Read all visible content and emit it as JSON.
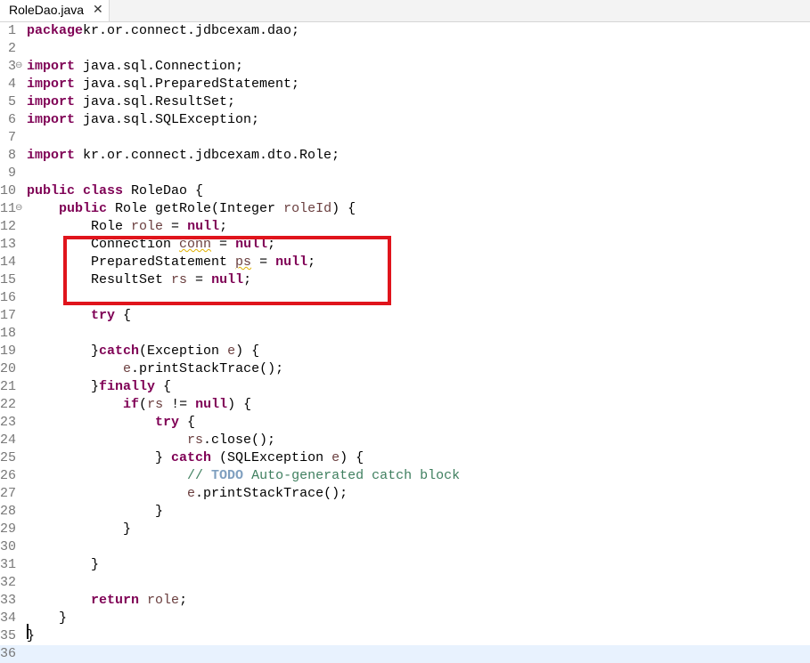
{
  "tab": {
    "title": "RoleDao.java",
    "close": "✕"
  },
  "editor": {
    "lines": [
      {
        "num": "1",
        "tokens": [
          [
            "kw",
            "package"
          ],
          [
            "",
            "kr.or.connect.jdbcexam.dao;"
          ]
        ]
      },
      {
        "num": "2",
        "tokens": []
      },
      {
        "num": "3",
        "fold": "⊖",
        "tokens": [
          [
            "kw",
            "import"
          ],
          [
            "",
            " java.sql.Connection;"
          ]
        ]
      },
      {
        "num": "4",
        "tokens": [
          [
            "kw",
            "import"
          ],
          [
            "",
            " java.sql.PreparedStatement;"
          ]
        ]
      },
      {
        "num": "5",
        "tokens": [
          [
            "kw",
            "import"
          ],
          [
            "",
            " java.sql.ResultSet;"
          ]
        ]
      },
      {
        "num": "6",
        "tokens": [
          [
            "kw",
            "import"
          ],
          [
            "",
            " java.sql.SQLException;"
          ]
        ]
      },
      {
        "num": "7",
        "tokens": []
      },
      {
        "num": "8",
        "tokens": [
          [
            "kw",
            "import"
          ],
          [
            "",
            " kr.or.connect.jdbcexam.dto.Role;"
          ]
        ]
      },
      {
        "num": "9",
        "tokens": []
      },
      {
        "num": "10",
        "tokens": [
          [
            "kw",
            "public class"
          ],
          [
            "",
            " RoleDao {"
          ]
        ]
      },
      {
        "num": "11",
        "fold": "⊖",
        "tokens": [
          [
            "",
            "    "
          ],
          [
            "kw",
            "public"
          ],
          [
            "",
            " Role getRole(Integer "
          ],
          [
            "var",
            "roleId"
          ],
          [
            "",
            ") {"
          ]
        ]
      },
      {
        "num": "12",
        "tokens": [
          [
            "",
            "        Role "
          ],
          [
            "var",
            "role"
          ],
          [
            "",
            " = "
          ],
          [
            "kw",
            "null"
          ],
          [
            "",
            ";"
          ]
        ]
      },
      {
        "num": "13",
        "tokens": [
          [
            "",
            "        Connection "
          ],
          [
            "var squig",
            "conn"
          ],
          [
            "",
            " = "
          ],
          [
            "kw",
            "null"
          ],
          [
            "",
            ";"
          ]
        ]
      },
      {
        "num": "14",
        "tokens": [
          [
            "",
            "        PreparedStatement "
          ],
          [
            "var squig",
            "ps"
          ],
          [
            "",
            " = "
          ],
          [
            "kw",
            "null"
          ],
          [
            "",
            ";"
          ]
        ]
      },
      {
        "num": "15",
        "tokens": [
          [
            "",
            "        ResultSet "
          ],
          [
            "var",
            "rs"
          ],
          [
            "",
            " = "
          ],
          [
            "kw",
            "null"
          ],
          [
            "",
            ";"
          ]
        ]
      },
      {
        "num": "16",
        "tokens": []
      },
      {
        "num": "17",
        "tokens": [
          [
            "",
            "        "
          ],
          [
            "kw",
            "try"
          ],
          [
            "",
            " {"
          ]
        ]
      },
      {
        "num": "18",
        "tokens": []
      },
      {
        "num": "19",
        "tokens": [
          [
            "",
            "        }"
          ],
          [
            "kw",
            "catch"
          ],
          [
            "",
            "(Exception "
          ],
          [
            "var",
            "e"
          ],
          [
            "",
            ") {"
          ]
        ]
      },
      {
        "num": "20",
        "tokens": [
          [
            "",
            "            "
          ],
          [
            "var",
            "e"
          ],
          [
            "",
            ".printStackTrace();"
          ]
        ]
      },
      {
        "num": "21",
        "tokens": [
          [
            "",
            "        }"
          ],
          [
            "kw",
            "finally"
          ],
          [
            "",
            " {"
          ]
        ]
      },
      {
        "num": "22",
        "tokens": [
          [
            "",
            "            "
          ],
          [
            "kw",
            "if"
          ],
          [
            "",
            "("
          ],
          [
            "var",
            "rs"
          ],
          [
            "",
            " != "
          ],
          [
            "kw",
            "null"
          ],
          [
            "",
            ") {"
          ]
        ]
      },
      {
        "num": "23",
        "tokens": [
          [
            "",
            "                "
          ],
          [
            "kw",
            "try"
          ],
          [
            "",
            " {"
          ]
        ]
      },
      {
        "num": "24",
        "tokens": [
          [
            "",
            "                    "
          ],
          [
            "var",
            "rs"
          ],
          [
            "",
            ".close();"
          ]
        ]
      },
      {
        "num": "25",
        "tokens": [
          [
            "",
            "                } "
          ],
          [
            "kw",
            "catch"
          ],
          [
            "",
            " (SQLException "
          ],
          [
            "var",
            "e"
          ],
          [
            "",
            ") {"
          ]
        ]
      },
      {
        "num": "26",
        "tokens": [
          [
            "",
            "                    "
          ],
          [
            "cm",
            "// "
          ],
          [
            "todo",
            "TODO"
          ],
          [
            "cm",
            " Auto-generated catch block"
          ]
        ]
      },
      {
        "num": "27",
        "tokens": [
          [
            "",
            "                    "
          ],
          [
            "var",
            "e"
          ],
          [
            "",
            ".printStackTrace();"
          ]
        ]
      },
      {
        "num": "28",
        "tokens": [
          [
            "",
            "                }"
          ]
        ]
      },
      {
        "num": "29",
        "tokens": [
          [
            "",
            "            }"
          ]
        ]
      },
      {
        "num": "30",
        "tokens": []
      },
      {
        "num": "31",
        "tokens": [
          [
            "",
            "        }"
          ]
        ]
      },
      {
        "num": "32",
        "tokens": []
      },
      {
        "num": "33",
        "tokens": [
          [
            "",
            "        "
          ],
          [
            "kw",
            "return"
          ],
          [
            "",
            " "
          ],
          [
            "var",
            "role"
          ],
          [
            "",
            ";"
          ]
        ]
      },
      {
        "num": "34",
        "tokens": [
          [
            "",
            "    }"
          ]
        ]
      },
      {
        "num": "35",
        "tokens": [
          [
            "",
            "}"
          ]
        ]
      },
      {
        "num": "36",
        "tokens": [],
        "current": true
      }
    ]
  },
  "colors": {
    "keyword": "#7f0055",
    "variable": "#6a3e3e",
    "comment": "#3f7f5f",
    "todo": "#7f9fbf",
    "highlight_box": "#e0141c",
    "current_line": "#e8f2fe"
  }
}
